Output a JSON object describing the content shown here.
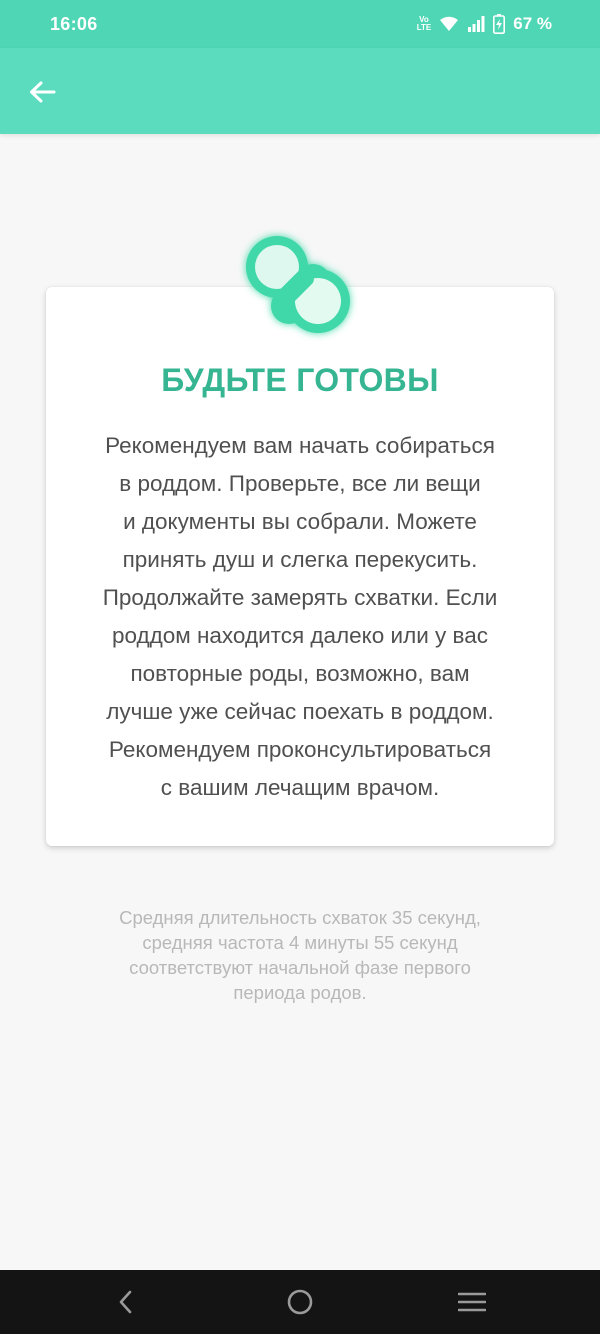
{
  "status_bar": {
    "time": "16:06",
    "battery_percent": "67 %",
    "volte_label": "VoLTE",
    "icons": [
      "volte-icon",
      "wifi-icon",
      "signal-icon",
      "battery-charging-icon"
    ]
  },
  "app_bar": {
    "back_icon": "arrow-left-icon",
    "color": "#5bdcbf"
  },
  "card": {
    "icon": "pacifier-icon",
    "title": "БУДЬТЕ ГОТОВЫ",
    "title_color": "#36b592",
    "lines": [
      "Рекомендуем вам начать собираться",
      "в роддом. Проверьте, все ли вещи",
      "и документы вы собрали. Можете",
      "принять душ и слегка перекусить.",
      "Продолжайте замерять схватки. Если",
      "роддом находится далеко или у вас",
      "повторные роды, возможно, вам",
      "лучше уже сейчас поехать в роддом.",
      "Рекомендуем проконсультироваться",
      "с вашим лечащим врачом."
    ]
  },
  "footnote": {
    "lines": [
      "Средняя длительность схваток 35 секунд,",
      "средняя частота 4 минуты 55 секунд",
      "соответствуют начальной фазе первого",
      "периода родов."
    ]
  },
  "nav_bar": {
    "buttons": [
      "nav-back-icon",
      "nav-home-icon",
      "nav-recents-icon"
    ]
  }
}
